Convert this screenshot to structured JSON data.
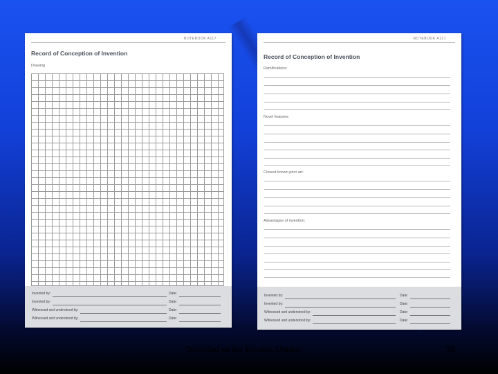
{
  "left_page": {
    "notebook_label": "NOTEBOOK  A117",
    "title": "Record of Conception of Invention",
    "section": "Drawing",
    "footer": [
      {
        "label": "Invented by:",
        "date_label": "Date:"
      },
      {
        "label": "Invented by:",
        "date_label": "Date:"
      },
      {
        "label": "Witnessed and understood by:",
        "date_label": "Date:"
      },
      {
        "label": "Witnessed and understood by:",
        "date_label": "Date:"
      }
    ]
  },
  "right_page": {
    "notebook_label": "NOTEBOOK  A121",
    "title": "Record of Conception of Invention",
    "sections": [
      {
        "label": "Ramifications:"
      },
      {
        "label": "Novel features:"
      },
      {
        "label": "Closest known prior art:"
      },
      {
        "label": "Advantages of invention:"
      }
    ],
    "footer": [
      {
        "label": "Invented by:",
        "date_label": "Date:"
      },
      {
        "label": "Invented by:",
        "date_label": "Date:"
      },
      {
        "label": "Witnessed and understood by:",
        "date_label": "Date:"
      },
      {
        "label": "Witnessed and understood by:",
        "date_label": "Date:"
      }
    ]
  },
  "caption": "Novedad en los Estados Unidos",
  "page_number": "28",
  "colors": {
    "background_top": "#1a52f0",
    "background_bottom": "#000000",
    "footer_band": "#dcdde0"
  }
}
